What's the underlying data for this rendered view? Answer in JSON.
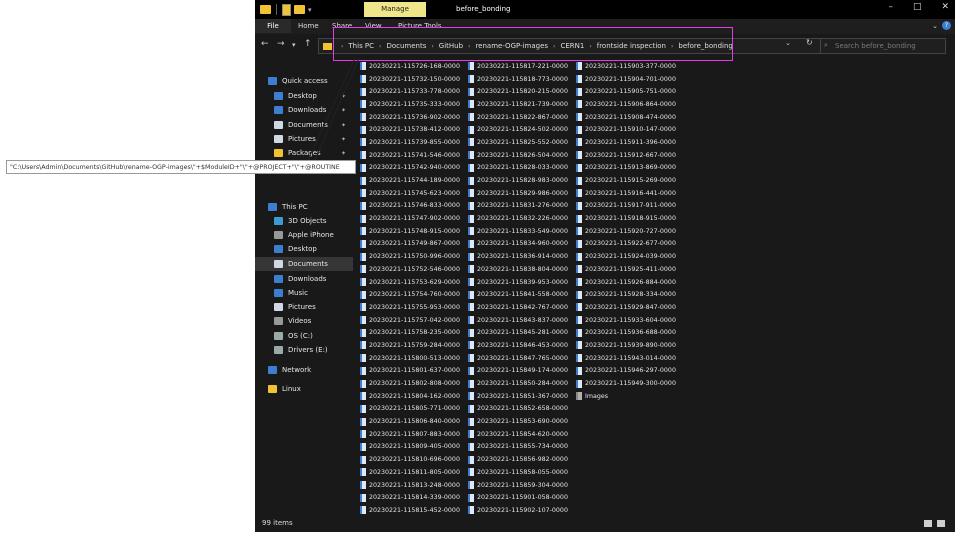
{
  "window": {
    "title": "before_bonding",
    "manage_tab": "Manage",
    "controls": [
      "–",
      "□",
      "✕"
    ]
  },
  "ribbon": {
    "file": "File",
    "tabs": [
      "Home",
      "Share",
      "View",
      "Picture Tools"
    ]
  },
  "address": {
    "breadcrumbs": [
      "This PC",
      "Documents",
      "GitHub",
      "rename-OGP-images",
      "CERN1",
      "frontside inspection",
      "before_bonding"
    ],
    "search_placeholder": "Search before_bonding"
  },
  "nav": {
    "items": [
      {
        "label": "Quick access",
        "icon": "star-icon"
      },
      {
        "label": "Desktop",
        "icon": "desktop-icon"
      },
      {
        "label": "Downloads",
        "icon": "download-icon"
      },
      {
        "label": "Documents",
        "icon": "documents-icon"
      },
      {
        "label": "Pictures",
        "icon": "pictures-icon"
      },
      {
        "label": "Packages",
        "icon": "folder-icon"
      },
      {
        "label": "This PC",
        "icon": "computer-icon"
      },
      {
        "label": "3D Objects",
        "icon": "cube-icon"
      },
      {
        "label": "Apple iPhone",
        "icon": "phone-icon"
      },
      {
        "label": "Desktop",
        "icon": "desktop-icon"
      },
      {
        "label": "Documents",
        "icon": "documents-icon"
      },
      {
        "label": "Downloads",
        "icon": "download-icon"
      },
      {
        "label": "Music",
        "icon": "music-icon"
      },
      {
        "label": "Pictures",
        "icon": "pictures-icon"
      },
      {
        "label": "Videos",
        "icon": "video-icon"
      },
      {
        "label": "OS (C:)",
        "icon": "drive-icon"
      },
      {
        "label": "Drivers (E:)",
        "icon": "drive-icon"
      },
      {
        "label": "Network",
        "icon": "network-icon"
      },
      {
        "label": "Linux",
        "icon": "linux-icon"
      }
    ]
  },
  "files": {
    "col1": [
      "20230221-115726-168-0000",
      "20230221-115732-150-0000",
      "20230221-115733-778-0000",
      "20230221-115735-333-0000",
      "20230221-115736-902-0000",
      "20230221-115738-412-0000",
      "20230221-115739-855-0000",
      "20230221-115741-546-0000",
      "20230221-115742-940-0000",
      "20230221-115744-189-0000",
      "20230221-115745-623-0000",
      "20230221-115746-833-0000",
      "20230221-115747-902-0000",
      "20230221-115748-915-0000",
      "20230221-115749-867-0000",
      "20230221-115750-996-0000",
      "20230221-115752-546-0000",
      "20230221-115753-629-0000",
      "20230221-115754-760-0000",
      "20230221-115755-953-0000",
      "20230221-115757-042-0000",
      "20230221-115758-235-0000",
      "20230221-115759-284-0000",
      "20230221-115800-513-0000",
      "20230221-115801-637-0000",
      "20230221-115802-808-0000",
      "20230221-115804-162-0000",
      "20230221-115805-771-0000",
      "20230221-115806-840-0000",
      "20230221-115807-883-0000",
      "20230221-115809-405-0000",
      "20230221-115810-696-0000",
      "20230221-115811-805-0000",
      "20230221-115813-248-0000",
      "20230221-115814-339-0000",
      "20230221-115815-452-0000"
    ],
    "col2": [
      "20230221-115817-221-0000",
      "20230221-115818-773-0000",
      "20230221-115820-215-0000",
      "20230221-115821-739-0000",
      "20230221-115822-867-0000",
      "20230221-115824-502-0000",
      "20230221-115825-552-0000",
      "20230221-115826-504-0000",
      "20230221-115828-033-0000",
      "20230221-115828-983-0000",
      "20230221-115829-986-0000",
      "20230221-115831-276-0000",
      "20230221-115832-226-0000",
      "20230221-115833-549-0000",
      "20230221-115834-960-0000",
      "20230221-115836-914-0000",
      "20230221-115838-804-0000",
      "20230221-115839-953-0000",
      "20230221-115841-558-0000",
      "20230221-115842-767-0000",
      "20230221-115843-837-0000",
      "20230221-115845-281-0000",
      "20230221-115846-453-0000",
      "20230221-115847-765-0000",
      "20230221-115849-174-0000",
      "20230221-115850-284-0000",
      "20230221-115851-367-0000",
      "20230221-115852-658-0000",
      "20230221-115853-690-0000",
      "20230221-115854-620-0000",
      "20230221-115855-734-0000",
      "20230221-115856-982-0000",
      "20230221-115858-055-0000",
      "20230221-115859-304-0000",
      "20230221-115901-058-0000",
      "20230221-115902-107-0000"
    ],
    "col3": [
      "20230221-115903-377-0000",
      "20230221-115904-701-0000",
      "20230221-115905-751-0000",
      "20230221-115906-864-0000",
      "20230221-115908-474-0000",
      "20230221-115910-147-0000",
      "20230221-115911-396-0000",
      "20230221-115912-667-0000",
      "20230221-115913-869-0000",
      "20230221-115915-269-0000",
      "20230221-115916-441-0000",
      "20230221-115917-911-0000",
      "20230221-115918-915-0000",
      "20230221-115920-727-0000",
      "20230221-115922-677-0000",
      "20230221-115924-039-0000",
      "20230221-115925-411-0000",
      "20230221-115926-884-0000",
      "20230221-115928-334-0000",
      "20230221-115929-847-0000",
      "20230221-115933-604-0000",
      "20230221-115936-688-0000",
      "20230221-115939-890-0000",
      "20230221-115943-014-0000",
      "20230221-115946-297-0000",
      "20230221-115949-300-0000",
      "Images"
    ]
  },
  "status": {
    "items_count": "99 items"
  },
  "callout": {
    "text": "\"C:\\Users\\Admin\\Documents\\GitHub\\rename-OGP-images\\\"+$ModuleID+\"\\\"+@PROJECT+\"\\\"+@ROUTINE"
  },
  "colors": {
    "accent": "#3c7fd1",
    "highlight": "#e23be8",
    "manage": "#f1e58a"
  }
}
